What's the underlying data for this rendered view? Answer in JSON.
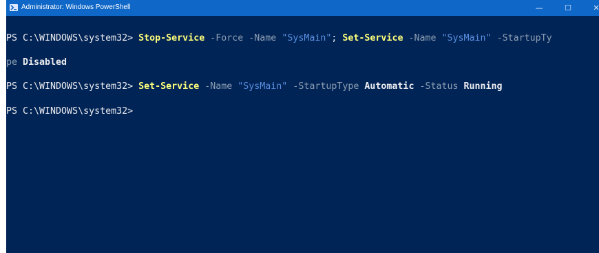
{
  "window": {
    "title": "Administrator: Windows PowerShell",
    "controls": {
      "minimize_glyph": "—",
      "maximize_glyph": "☐",
      "close_glyph": "✕"
    },
    "icon": "powershell-icon",
    "colors": {
      "titlebar": "#0f67c7",
      "console_background": "#012456",
      "cmdlet": "#ffff7a",
      "parameter": "#8f9fb3",
      "string": "#5a8fe0",
      "text": "#eeedf0"
    }
  },
  "console": {
    "line1": {
      "prompt": "PS C:\\WINDOWS\\system32> ",
      "cmd1": "Stop-Service",
      "p1": " -Force",
      "p2": " -Name",
      "s1": " \"SysMain\"",
      "sep": "; ",
      "cmd2": "Set-Service",
      "p3": " -Name",
      "s2": " \"SysMain\"",
      "p4": " -StartupTy"
    },
    "line2": {
      "wrap": "pe",
      "value": " Disabled"
    },
    "line3": {
      "prompt": "PS C:\\WINDOWS\\system32> ",
      "cmd": "Set-Service",
      "p1": " -Name",
      "s1": " \"SysMain\"",
      "p2": " -StartupType",
      "v1": " Automatic",
      "p3": " -Status",
      "v2": " Running"
    },
    "line4": {
      "prompt": "PS C:\\WINDOWS\\system32>"
    }
  }
}
